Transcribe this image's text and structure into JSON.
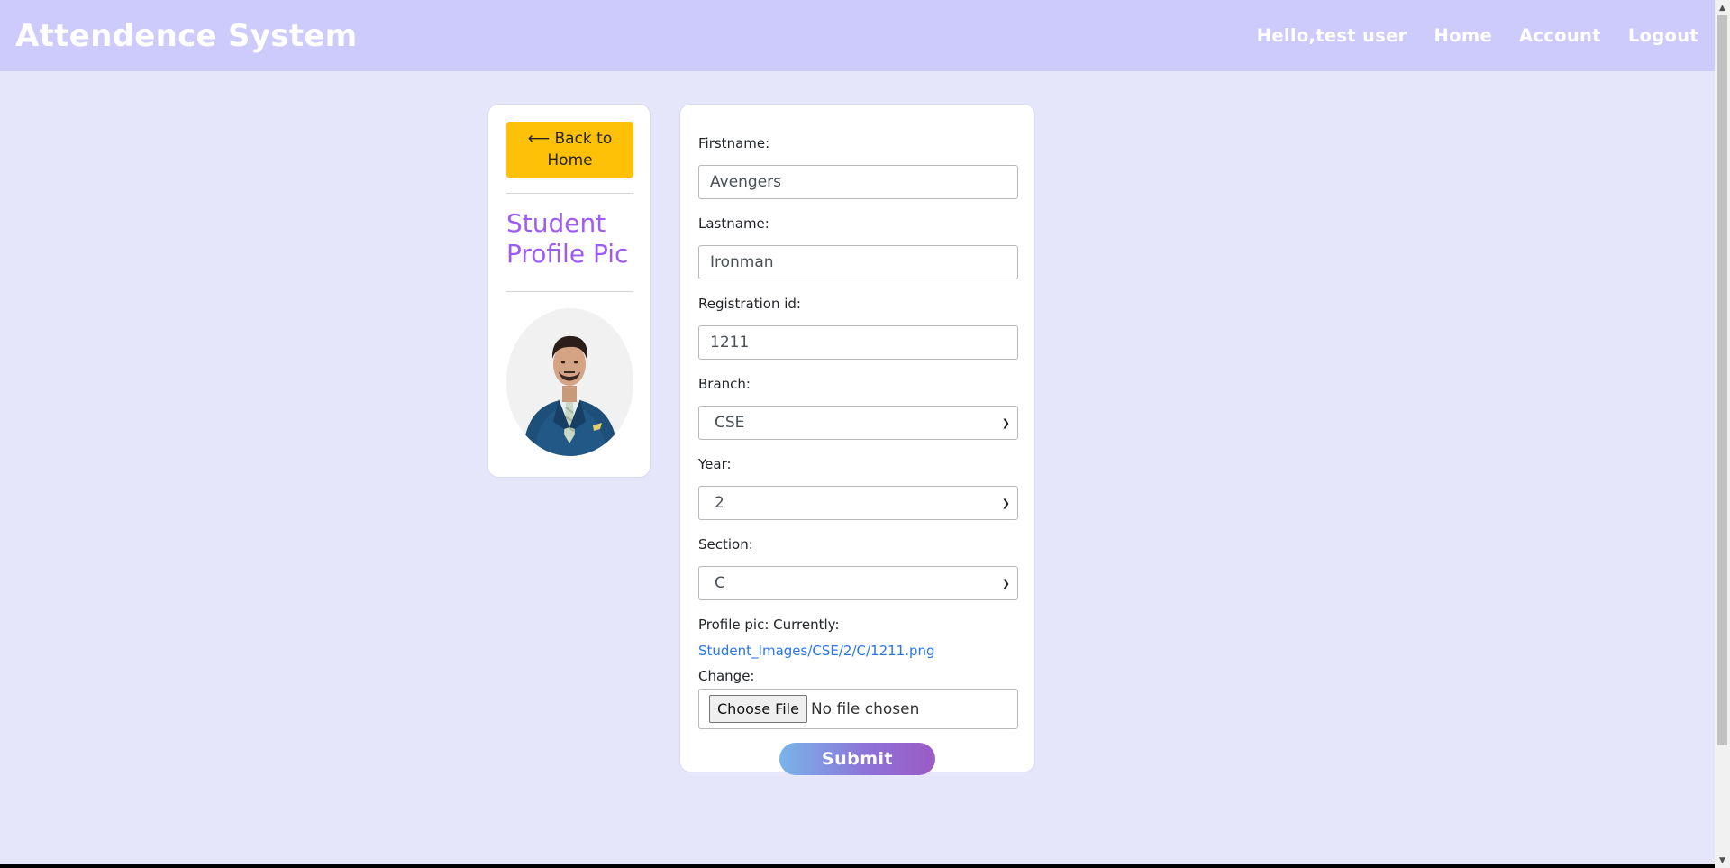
{
  "navbar": {
    "brand": "Attendence System",
    "greeting": "Hello,test user",
    "links": [
      "Home",
      "Account",
      "Logout"
    ]
  },
  "sidebar": {
    "back_label": "⟵ Back to Home",
    "title": "Student Profile Pic"
  },
  "form": {
    "firstname": {
      "label": "Firstname:",
      "value": "Avengers"
    },
    "lastname": {
      "label": "Lastname:",
      "value": "Ironman"
    },
    "registration": {
      "label": "Registration id:",
      "value": "1211"
    },
    "branch": {
      "label": "Branch:",
      "value": "CSE"
    },
    "year": {
      "label": "Year:",
      "value": "2"
    },
    "section": {
      "label": "Section:",
      "value": "C"
    },
    "profile_pic": {
      "label": "Profile pic: Currently:",
      "current": "Student_Images/CSE/2/C/1211.png",
      "change_label": "Change:",
      "choose_label": "Choose File",
      "no_file": "No file chosen"
    },
    "submit_label": "Submit"
  },
  "colors": {
    "navbar_bg": "#cccbfb",
    "page_bg": "#e6e6fb",
    "back_button": "#ffc107",
    "title_purple": "#9e5cf2",
    "link_blue": "#2a75e8"
  },
  "icons": {
    "select_chevron": "chevron-down-icon",
    "scroll_up": "scroll-up-arrow-icon",
    "scroll_down": "scroll-down-arrow-icon"
  }
}
